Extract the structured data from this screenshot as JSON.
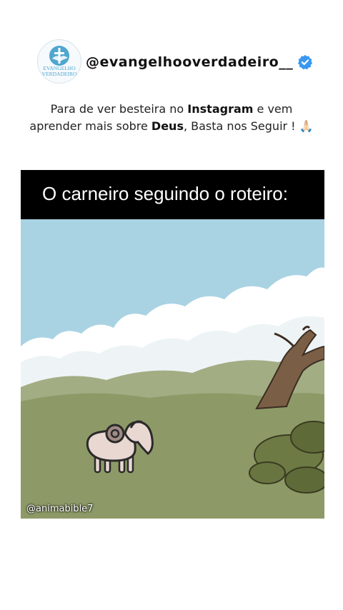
{
  "profile": {
    "avatar_line1": "EVANGELHO",
    "avatar_line2": "VERDADEIRO",
    "username": "@evangelhooverdadeiro__",
    "verified": true
  },
  "caption": {
    "p1": "Para de ver besteira no ",
    "b1": "Instagram",
    "p2": " e vem aprender mais sobre ",
    "b2": "Deus",
    "p3": ", Basta nos Seguir ! 🙏🏻"
  },
  "video": {
    "title": "O carneiro seguindo o roteiro:",
    "watermark": "@animabible7"
  },
  "colors": {
    "accent": "#4fa6cf",
    "verified_badge": "#3897f0",
    "sky": "#a9d3e3",
    "grass": "#8d9a67"
  }
}
